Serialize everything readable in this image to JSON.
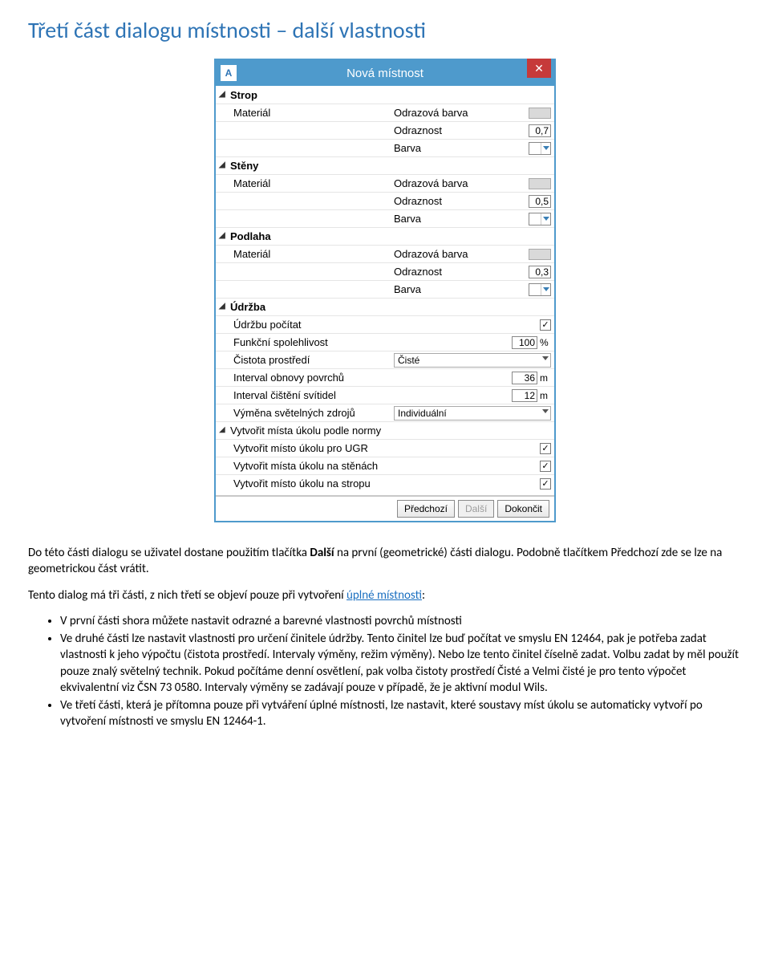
{
  "heading": "Třetí část dialogu místnosti – další vlastnosti",
  "dialog": {
    "title": "Nová místnost",
    "app_icon_letter": "A",
    "close_glyph": "✕",
    "groups": {
      "strop": {
        "title": "Strop",
        "material": "Materiál",
        "odrazova_barva": "Odrazová barva",
        "odraznost_label": "Odraznost",
        "odraznost_value": "0,7",
        "barva": "Barva"
      },
      "steny": {
        "title": "Stěny",
        "material": "Materiál",
        "odrazova_barva": "Odrazová barva",
        "odraznost_label": "Odraznost",
        "odraznost_value": "0,5",
        "barva": "Barva"
      },
      "podlaha": {
        "title": "Podlaha",
        "material": "Materiál",
        "odrazova_barva": "Odrazová barva",
        "odraznost_label": "Odraznost",
        "odraznost_value": "0,3",
        "barva": "Barva"
      },
      "udrzba": {
        "title": "Údržba",
        "pocitat": "Údržbu počítat",
        "spolehlivost_label": "Funkční spolehlivost",
        "spolehlivost_value": "100",
        "spolehlivost_unit": "%",
        "cistota_label": "Čistota prostředí",
        "cistota_value": "Čisté",
        "interval_povrchu_label": "Interval obnovy povrchů",
        "interval_povrchu_value": "36",
        "interval_povrchu_unit": "m",
        "interval_svitidel_label": "Interval čištění svítidel",
        "interval_svitidel_value": "12",
        "interval_svitidel_unit": "m",
        "vymena_label": "Výměna světelných zdrojů",
        "vymena_value": "Individuální"
      },
      "norma": {
        "title": "Vytvořit místa úkolu podle normy",
        "ugr": "Vytvořit místo úkolu pro UGR",
        "steny": "Vytvořit místa úkolu na stěnách",
        "strop": "Vytvořit místo úkolu na stropu"
      }
    },
    "checkmark": "✓",
    "footer": {
      "prev": "Předchozí",
      "next": "Další",
      "finish": "Dokončit"
    }
  },
  "p1": {
    "a": "Do této části dialogu se uživatel dostane použitím tlačítka ",
    "bold1": "Další",
    "b": " na první (geometrické) části dialogu. Podobně tlačítkem Předchozí zde se lze na geometrickou část vrátit."
  },
  "p2": {
    "a": "Tento dialog má tři části, z nich třetí se objeví pouze při vytvoření ",
    "link": "úplné místnosti",
    "b": ":"
  },
  "bullets": {
    "b1": "V první části shora můžete nastavit odrazné a barevné vlastnosti povrchů místnosti",
    "b2": "Ve druhé části lze nastavit vlastnosti pro určení činitele údržby. Tento činitel lze buď počítat ve smyslu EN 12464, pak je potřeba zadat vlastnosti k jeho výpočtu (čistota prostředí. Intervaly výměny, režim výměny). Nebo lze tento činitel číselně zadat. Volbu zadat by měl použít pouze znalý světelný technik. Pokud počítáme denní osvětlení, pak volba čistoty prostředí Čisté a Velmi čisté je pro tento výpočet ekvivalentní viz ČSN 73 0580. Intervaly výměny se zadávají pouze v případě, že je aktivní modul Wils.",
    "b3": "Ve třetí části, která je přítomna pouze při vytváření úplné místnosti, lze nastavit, které soustavy míst úkolu se automaticky vytvoří po vytvoření místnosti ve smyslu EN 12464-1."
  }
}
